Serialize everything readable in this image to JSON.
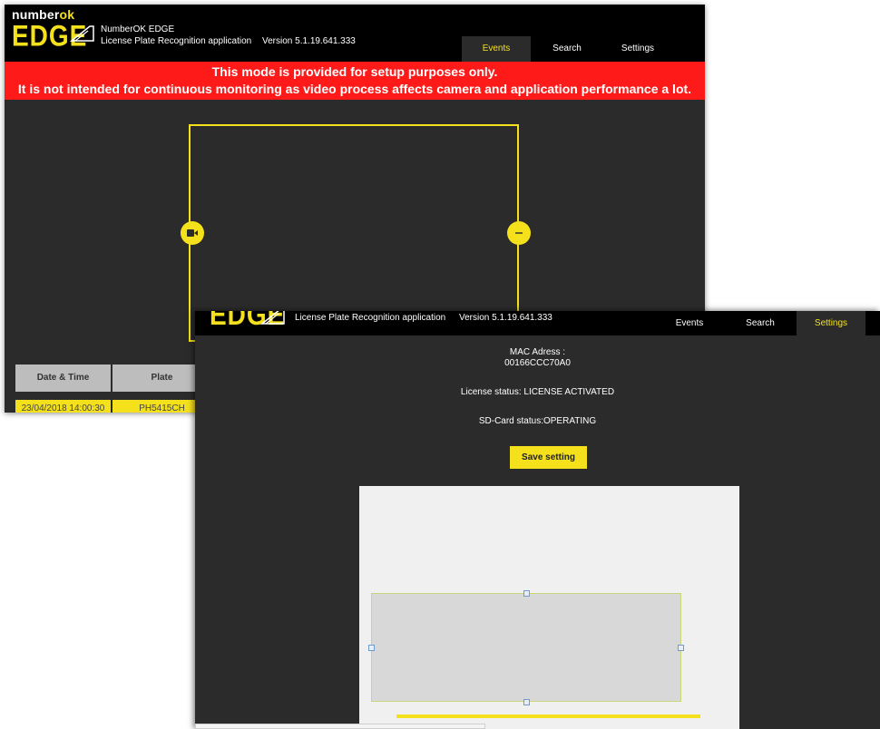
{
  "events_window": {
    "brand": {
      "word_main": "number",
      "word_accent": "ok",
      "product": "EDGE"
    },
    "app_name": "NumberOK EDGE",
    "app_subtitle": "License Plate Recognition application",
    "version": "Version 5.1.19.641.333",
    "tabs": [
      "Events",
      "Search",
      "Settings"
    ],
    "active_tab": "Events",
    "warning_line1": "This mode is provided for setup purposes only.",
    "warning_line2": "It is not intended for continuous monitoring as video process affects camera and application performance a lot.",
    "table": {
      "columns": [
        "Date & Time",
        "Plate"
      ],
      "rows": [
        [
          "23/04/2018 14:00:30",
          "PH5415CH"
        ]
      ]
    },
    "handle_icons": [
      "video-camera-icon",
      "minus-icon"
    ]
  },
  "settings_window": {
    "product": "EDGE",
    "app_subtitle": "License Plate Recognition application",
    "version": "Version 5.1.19.641.333",
    "tabs": [
      "Events",
      "Search",
      "Settings"
    ],
    "active_tab": "Settings",
    "mac_label": "MAC Adress :",
    "mac_value": "00166CCC70A0",
    "license_status": "License status: LICENSE ACTIVATED",
    "sd_status": "SD-Card status:OPERATING",
    "save_button": "Save setting"
  },
  "colors": {
    "accent_yellow": "#f4e11c",
    "warning_red": "#ff1a1a",
    "panel_dark": "#2b2b2b",
    "header_black": "#000000"
  }
}
